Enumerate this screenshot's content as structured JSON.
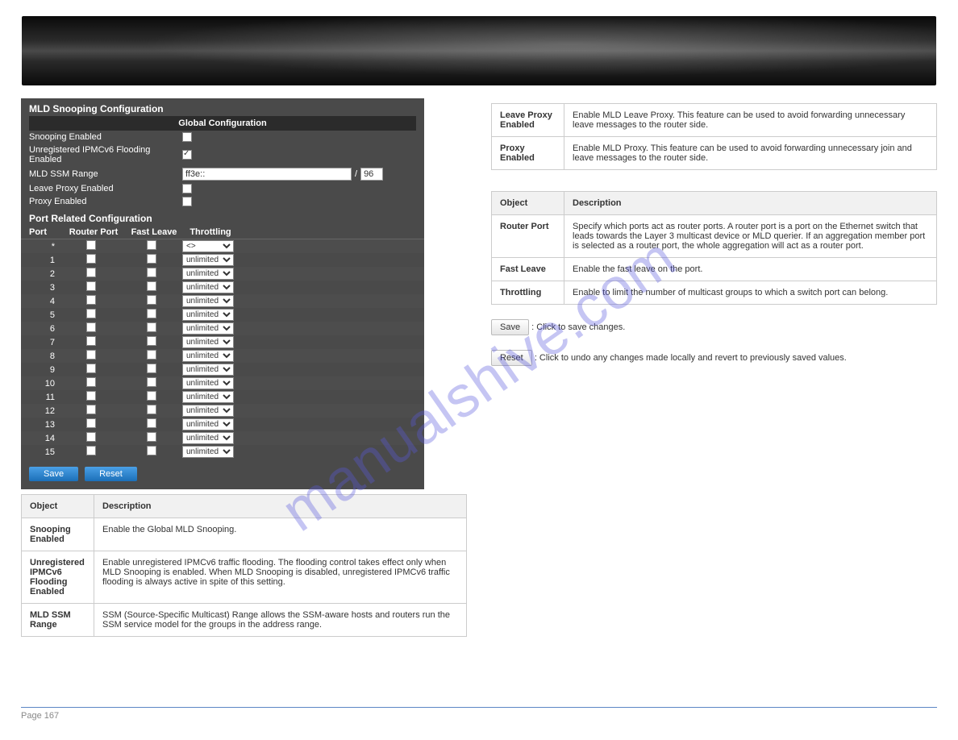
{
  "banner": {
    "brand": ""
  },
  "screenshot": {
    "title": "MLD Snooping Configuration",
    "global_header": "Global Configuration",
    "rows": {
      "snooping_enabled": {
        "label": "Snooping Enabled",
        "checked": false
      },
      "unreg_flood": {
        "label": "Unregistered IPMCv6 Flooding Enabled",
        "checked": true
      },
      "ssm_range": {
        "label": "MLD SSM Range",
        "value": "ff3e::",
        "sep": "/",
        "prefix": "96"
      },
      "leave_proxy": {
        "label": "Leave Proxy Enabled",
        "checked": false
      },
      "proxy_enabled": {
        "label": "Proxy Enabled",
        "checked": false
      }
    },
    "port_section_title": "Port Related Configuration",
    "port_headers": [
      "Port",
      "Router Port",
      "Fast Leave",
      "Throttling"
    ],
    "star_throttle": "<>",
    "ports": [
      {
        "port": "1",
        "router": false,
        "fast": false,
        "throttle": "unlimited"
      },
      {
        "port": "2",
        "router": false,
        "fast": false,
        "throttle": "unlimited"
      },
      {
        "port": "3",
        "router": false,
        "fast": false,
        "throttle": "unlimited"
      },
      {
        "port": "4",
        "router": false,
        "fast": false,
        "throttle": "unlimited"
      },
      {
        "port": "5",
        "router": false,
        "fast": false,
        "throttle": "unlimited"
      },
      {
        "port": "6",
        "router": false,
        "fast": false,
        "throttle": "unlimited"
      },
      {
        "port": "7",
        "router": false,
        "fast": false,
        "throttle": "unlimited"
      },
      {
        "port": "8",
        "router": false,
        "fast": false,
        "throttle": "unlimited"
      },
      {
        "port": "9",
        "router": false,
        "fast": false,
        "throttle": "unlimited"
      },
      {
        "port": "10",
        "router": false,
        "fast": false,
        "throttle": "unlimited"
      },
      {
        "port": "11",
        "router": false,
        "fast": false,
        "throttle": "unlimited"
      },
      {
        "port": "12",
        "router": false,
        "fast": false,
        "throttle": "unlimited"
      },
      {
        "port": "13",
        "router": false,
        "fast": false,
        "throttle": "unlimited"
      },
      {
        "port": "14",
        "router": false,
        "fast": false,
        "throttle": "unlimited"
      },
      {
        "port": "15",
        "router": false,
        "fast": false,
        "throttle": "unlimited"
      }
    ],
    "buttons": {
      "save": "Save",
      "reset": "Reset"
    }
  },
  "table_left": {
    "header_obj": "Object",
    "header_desc": "Description",
    "rows": [
      {
        "obj": "Snooping Enabled",
        "desc": "Enable the Global MLD Snooping."
      },
      {
        "obj": "Unregistered IPMCv6 Flooding Enabled",
        "desc": "Enable unregistered IPMCv6 traffic flooding. The flooding control takes effect only when MLD Snooping is enabled. When MLD Snooping is disabled, unregistered IPMCv6 traffic flooding is always active in spite of this setting."
      },
      {
        "obj": "MLD SSM Range",
        "desc": "SSM (Source-Specific Multicast) Range allows the SSM-aware hosts and routers run the SSM service model for the groups in the address range."
      }
    ]
  },
  "table_right1": {
    "rows": [
      {
        "obj": "Leave Proxy Enabled",
        "desc": "Enable MLD Leave Proxy. This feature can be used to avoid forwarding unnecessary leave messages to the router side."
      },
      {
        "obj": "Proxy Enabled",
        "desc": "Enable MLD Proxy. This feature can be used to avoid forwarding unnecessary join and leave messages to the router side."
      }
    ]
  },
  "table_right2": {
    "header_obj": "Object",
    "header_desc": "Description",
    "rows": [
      {
        "obj": "Router Port",
        "desc": "Specify which ports act as router ports. A router port is a port on the Ethernet switch that leads towards the Layer 3 multicast device or MLD querier. If an aggregation member port is selected as a router port, the whole aggregation will act as a router port."
      },
      {
        "obj": "Fast Leave",
        "desc": "Enable the fast leave on the port."
      },
      {
        "obj": "Throttling",
        "desc": "Enable to limit the number of multicast groups to which a switch port can belong."
      }
    ]
  },
  "right_buttons": {
    "save": {
      "label": "Save",
      "desc": ": Click to save changes."
    },
    "reset": {
      "label": "Reset",
      "desc": ": Click to undo any changes made locally and revert to previously saved values."
    }
  },
  "watermark": "manualshive.com",
  "page_footer": "Page 167"
}
